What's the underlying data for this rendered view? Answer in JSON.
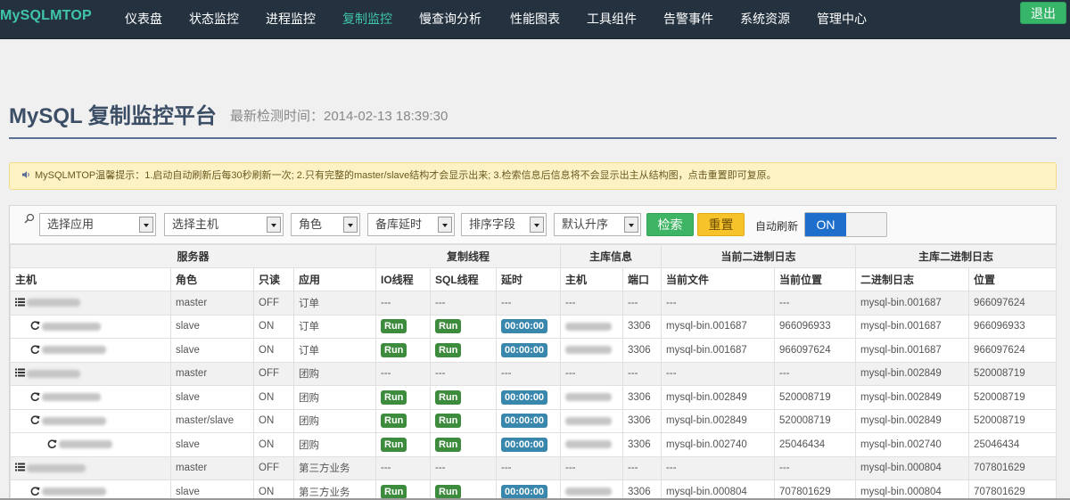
{
  "nav": {
    "brand": "MySQLMTOP",
    "items": [
      {
        "label": "仪表盘"
      },
      {
        "label": "状态监控"
      },
      {
        "label": "进程监控"
      },
      {
        "label": "复制监控"
      },
      {
        "label": "慢查询分析"
      },
      {
        "label": "性能图表"
      },
      {
        "label": "工具组件"
      },
      {
        "label": "告警事件"
      },
      {
        "label": "系统资源"
      },
      {
        "label": "管理中心"
      }
    ],
    "active": "复制监控",
    "logout_label": "退出"
  },
  "header": {
    "title": "MySQL 复制监控平台",
    "subtitle": "最新检测时间：2014-02-13 18:39:30"
  },
  "alert": {
    "text": "MySQLMTOP温馨提示：1.启动自动刷新后每30秒刷新一次; 2.只有完整的master/slave结构才会显示出来; 3.检索信息后信息将不会显示出主从结构图，点击重置即可复原。"
  },
  "filters": {
    "app": "选择应用",
    "host": "选择主机",
    "role": "角色",
    "delay": "备库延时",
    "sort": "排序字段",
    "order": "默认升序",
    "search_label": "检索",
    "reset_label": "重置",
    "auto_refresh_label": "自动刷新",
    "toggle_on": "ON"
  },
  "table": {
    "groups": [
      "服务器",
      "复制线程",
      "主库信息",
      "当前二进制日志",
      "主库二进制日志"
    ],
    "columns": [
      "主机",
      "角色",
      "只读",
      "应用",
      "IO线程",
      "SQL线程",
      "延时",
      "主机",
      "端口",
      "当前文件",
      "当前位置",
      "二进制日志",
      "位置"
    ],
    "rows": [
      {
        "level": 0,
        "host": "10.0.0.00:0006",
        "role": "master",
        "readonly": "OFF",
        "app": "订单",
        "io": "---",
        "sql": "---",
        "delay": "---",
        "mhost": "---",
        "port": "---",
        "file": "---",
        "pos": "---",
        "mlog": "mysql-bin.001687",
        "mpos": "966097624"
      },
      {
        "level": 1,
        "host": "10.0.0.00:0006",
        "role": "slave",
        "readonly": "ON",
        "app": "订单",
        "io": "Run",
        "sql": "Run",
        "delay": "00:00:00",
        "mhost": "10.0.0.00",
        "port": "3306",
        "file": "mysql-bin.001687",
        "pos": "966096933",
        "mlog": "mysql-bin.001687",
        "mpos": "966096933"
      },
      {
        "level": 1,
        "host": "10.0.0.70:3306",
        "role": "slave",
        "readonly": "ON",
        "app": "订单",
        "io": "Run",
        "sql": "Run",
        "delay": "00:00:00",
        "mhost": "10.0.0.00",
        "port": "3306",
        "file": "mysql-bin.001687",
        "pos": "966097624",
        "mlog": "mysql-bin.001687",
        "mpos": "966097624"
      },
      {
        "level": 0,
        "host": "10.0.0.07:0000",
        "role": "master",
        "readonly": "OFF",
        "app": "团购",
        "io": "---",
        "sql": "---",
        "delay": "---",
        "mhost": "---",
        "port": "---",
        "file": "---",
        "pos": "---",
        "mlog": "mysql-bin.002849",
        "mpos": "520008719"
      },
      {
        "level": 1,
        "host": "10.0.0.00:0006",
        "role": "slave",
        "readonly": "ON",
        "app": "团购",
        "io": "Run",
        "sql": "Run",
        "delay": "00:00:00",
        "mhost": "10.0.0.07",
        "port": "3306",
        "file": "mysql-bin.002849",
        "pos": "520008719",
        "mlog": "mysql-bin.002849",
        "mpos": "520008719"
      },
      {
        "level": 1,
        "host": "10.0.0.00:0000",
        "role": "master/slave",
        "readonly": "ON",
        "app": "团购",
        "io": "Run",
        "sql": "Run",
        "delay": "00:00:00",
        "mhost": "10.0.0.07",
        "port": "3306",
        "file": "mysql-bin.002849",
        "pos": "520008719",
        "mlog": "mysql-bin.002849",
        "mpos": "520008719"
      },
      {
        "level": 2,
        "host": "10.0.0.000:00000",
        "role": "slave",
        "readonly": "ON",
        "app": "团购",
        "io": "Run",
        "sql": "Run",
        "delay": "00:00:00",
        "mhost": "10.0.0.00",
        "port": "3306",
        "file": "mysql-bin.002740",
        "pos": "25046434",
        "mlog": "mysql-bin.002740",
        "mpos": "25046434"
      },
      {
        "level": 0,
        "host": "10.0.0.00:0006",
        "role": "master",
        "readonly": "OFF",
        "app": "第三方业务",
        "io": "---",
        "sql": "---",
        "delay": "---",
        "mhost": "---",
        "port": "---",
        "file": "---",
        "pos": "---",
        "mlog": "mysql-bin.000804",
        "mpos": "707801629"
      },
      {
        "level": 1,
        "host": "10.0.0.01:0006",
        "role": "slave",
        "readonly": "ON",
        "app": "第三方业务",
        "io": "Run",
        "sql": "Run",
        "delay": "00:00:00",
        "mhost": "10.0.0.00",
        "port": "3306",
        "file": "mysql-bin.000804",
        "pos": "707801629",
        "mlog": "mysql-bin.000804",
        "mpos": "707801629"
      }
    ]
  },
  "colors": {
    "nav_bg": "#24313f",
    "accent": "#3fc6a8",
    "run_badge": "#3d8b3d",
    "delay_badge": "#3a87ad",
    "toggle_on": "#1e6fcc"
  }
}
